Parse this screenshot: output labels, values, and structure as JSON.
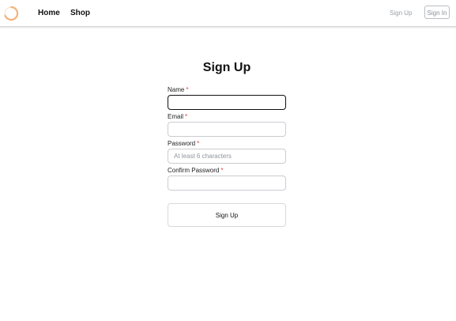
{
  "nav": {
    "home": "Home",
    "shop": "Shop",
    "signup": "Sign Up",
    "signin": "Sign In"
  },
  "form": {
    "title": "Sign Up",
    "required_mark": "*",
    "fields": [
      {
        "label": "Name",
        "value": "",
        "placeholder": ""
      },
      {
        "label": "Email",
        "value": "",
        "placeholder": ""
      },
      {
        "label": "Password",
        "value": "",
        "placeholder": "At least 6 characters"
      },
      {
        "label": "Confirm Password",
        "value": "",
        "placeholder": ""
      }
    ],
    "submit": "Sign Up"
  },
  "colors": {
    "logo_accent": "#f2b27a",
    "required": "#e53935",
    "muted_nav": "#9aa0a6"
  },
  "icons": {
    "logo": "spinner-ring-icon"
  }
}
